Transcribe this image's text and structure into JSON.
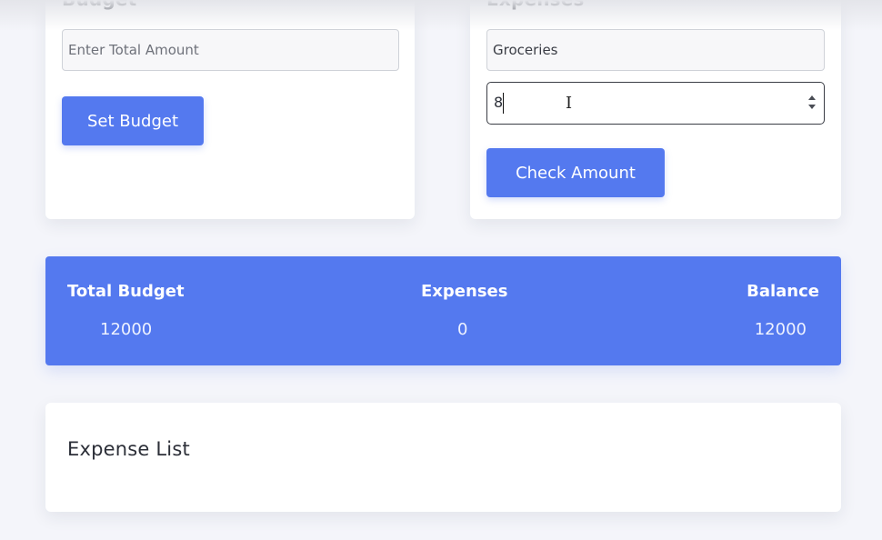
{
  "budget": {
    "title": "Budget",
    "amount_placeholder": "Enter Total Amount",
    "amount_value": "",
    "set_button_label": "Set Budget"
  },
  "expenses": {
    "title": "Expenses",
    "title_field_value": "Groceries",
    "amount_value": "8",
    "check_button_label": "Check Amount"
  },
  "summary": {
    "total_budget_label": "Total Budget",
    "total_budget_value": "12000",
    "expenses_label": "Expenses",
    "expenses_value": "0",
    "balance_label": "Balance",
    "balance_value": "12000"
  },
  "expense_list": {
    "title": "Expense List"
  },
  "colors": {
    "accent": "#5479ef",
    "background": "#f4f5fa",
    "card": "#ffffff",
    "heading_text": "#2c2f38"
  },
  "icons": {
    "number_spinner": "spinner-arrows-icon",
    "mouse_cursor": "text-cursor-icon"
  }
}
